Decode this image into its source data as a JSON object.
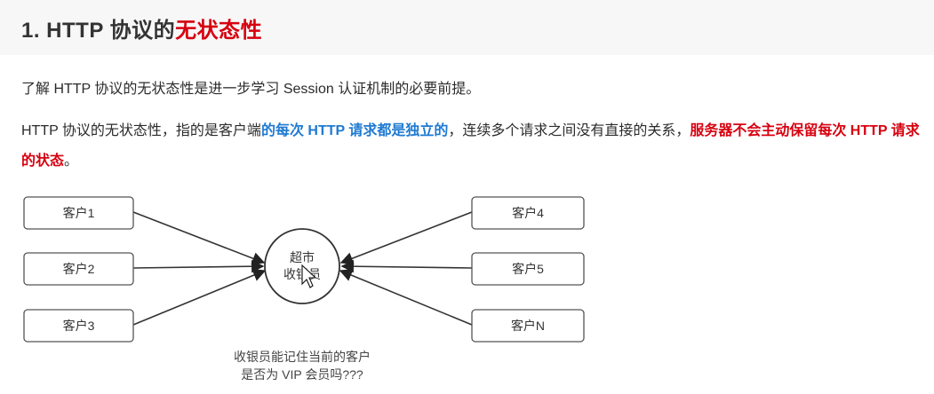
{
  "title": {
    "prefix": "1. HTTP 协议的",
    "highlight": "无状态性"
  },
  "paragraph1": "了解 HTTP 协议的无状态性是进一步学习 Session 认证机制的必要前提。",
  "paragraph2": {
    "part1": "HTTP 协议的无状态性，指的是客户端",
    "blue": "的每次 HTTP 请求都是独立的",
    "part2": "，连续多个请求之间没有直接的关系，",
    "red": "服务器不会主动保留每次 HTTP 请求的状态",
    "end": "。"
  },
  "diagram": {
    "left_clients": [
      "客户1",
      "客户2",
      "客户3"
    ],
    "right_clients": [
      "客户4",
      "客户5",
      "客户N"
    ],
    "center_line1": "超市",
    "center_line2": "收银员",
    "caption_line1": "收银员能记住当前的客户",
    "caption_line2": "是否为 VIP 会员吗???"
  },
  "colors": {
    "highlight_red": "#d7000f",
    "highlight_blue": "#1f7ad1"
  }
}
